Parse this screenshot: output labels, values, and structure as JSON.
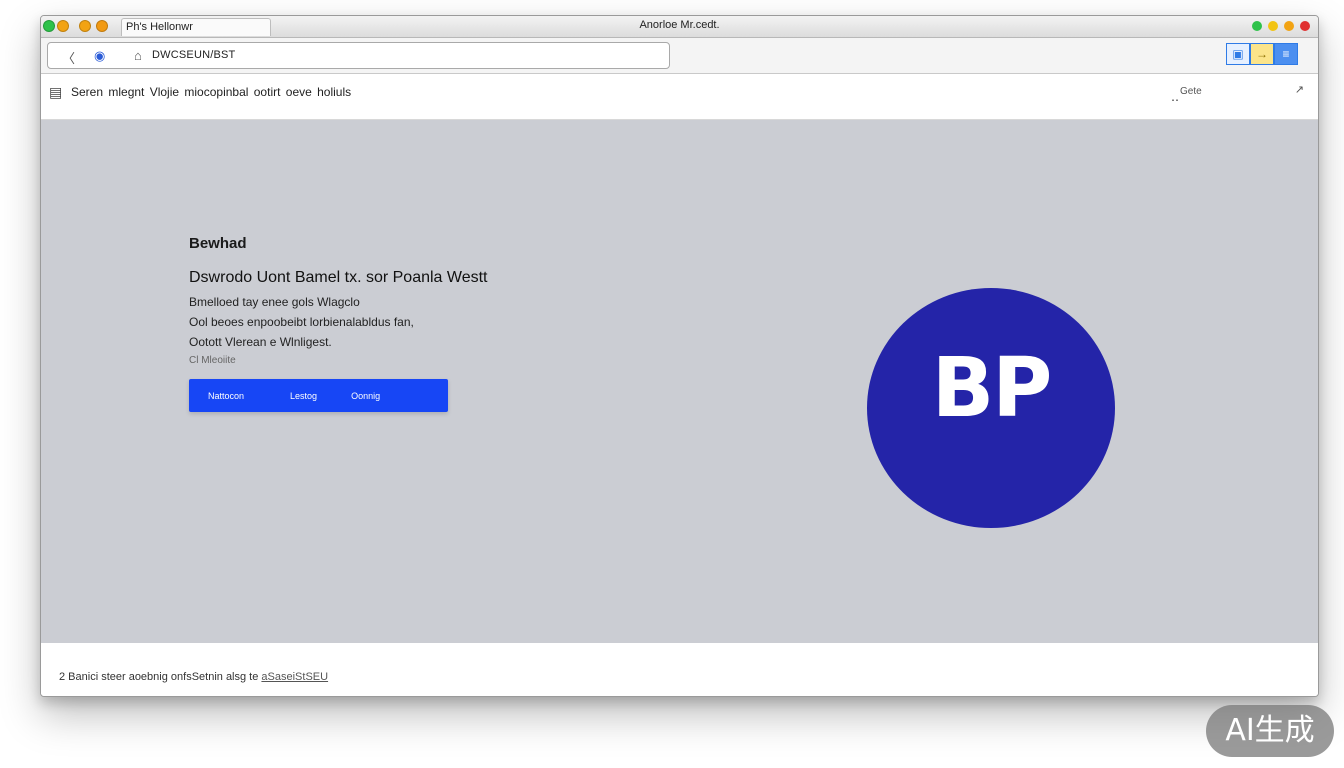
{
  "window": {
    "tab_title": "Ph's Hellonwr",
    "title": "Anorloe Mr.cedt.",
    "status_dot_colors": [
      "#2ec24a",
      "#f2c413",
      "#f2a313",
      "#e03030"
    ]
  },
  "toolbar": {
    "url": "DWCSEUN/BST",
    "back_icon": "back-icon",
    "cast_icon": "cast-icon",
    "lock_icon": "lock-icon"
  },
  "infobar": {
    "text": "Seren mlegnt Vlojie miocopinbal ootirt oeve holiuls",
    "side_label": "Gete"
  },
  "hero": {
    "eyebrow": "Bewhad",
    "heading": "Dswrodo Uont Bamel tx. sor Poanla Westt",
    "lines": [
      "Bmelloed tay enee gols Wlagclo",
      "Ool beoes enpoobeibt lorbienalabldus fan,",
      "Ootott Vlerean e Wlnligest."
    ],
    "small_line": "Cl Mleoiite",
    "buttons": [
      "Nattocon",
      "Lestog",
      "Oonnig"
    ]
  },
  "logo": {
    "text": "BP",
    "color": "#2424a8"
  },
  "footer": {
    "text": "2 Banici steer aoebnig onfsSetnin alsg te",
    "link": "aSaseiStSEU"
  },
  "watermark": {
    "text": "AI生成"
  }
}
